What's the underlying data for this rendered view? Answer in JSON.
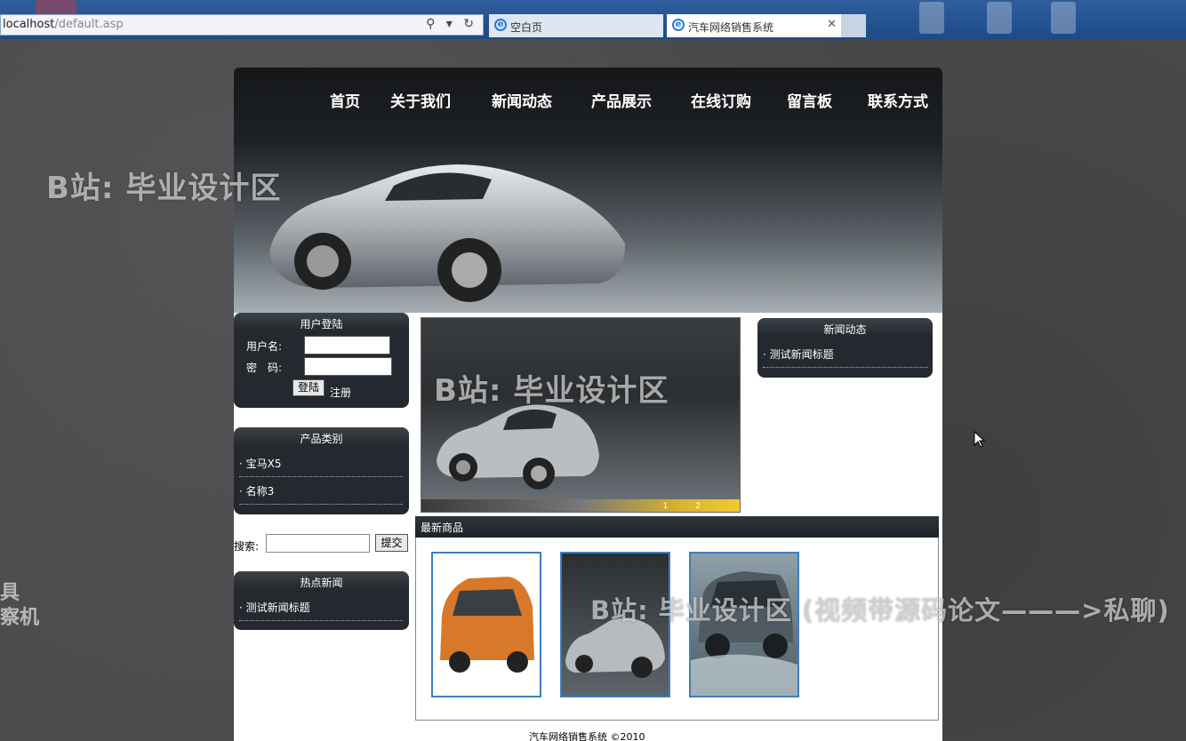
{
  "browser": {
    "address_host": "localhost",
    "address_path": "/default.asp",
    "tabs": [
      {
        "label": "空白页"
      },
      {
        "label": "汽车网络销售系统"
      }
    ]
  },
  "site": {
    "nav": [
      "首页",
      "关于我们",
      "新闻动态",
      "产品展示",
      "在线订购",
      "留言板",
      "联系方式"
    ],
    "login": {
      "title": "用户登陆",
      "username_label": "用户名:",
      "password_label": "密　码:",
      "login_button": "登陆",
      "register_link": "注册"
    },
    "categories": {
      "title": "产品类别",
      "items": [
        "· 宝马X5",
        "· 名称3"
      ]
    },
    "search": {
      "label": "搜索:",
      "button": "提交"
    },
    "hot_news": {
      "title": "热点新闻",
      "items": [
        "· 测试新闻标题"
      ]
    },
    "news": {
      "title": "新闻动态",
      "items": [
        "· 测试新闻标题"
      ]
    },
    "slider_pages": "1 2",
    "latest": {
      "title": "最新商品"
    },
    "footer": "汽车网络销售系统 ©2010"
  },
  "watermarks": {
    "main": "B站: 毕业设计区",
    "bottom": "B站: 毕业设计区 (视频带源码论文———>私聊)",
    "side": [
      "具",
      "察机"
    ]
  }
}
